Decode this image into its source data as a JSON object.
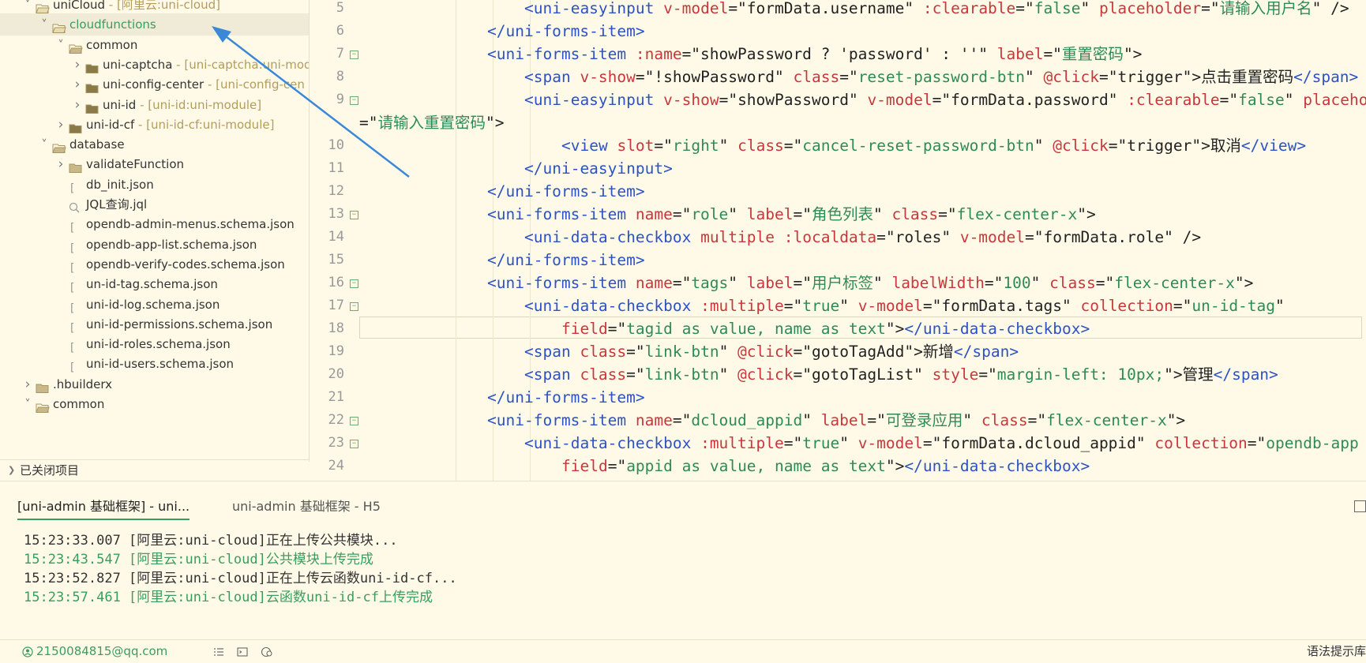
{
  "sidebar": {
    "items": [
      {
        "label": "uniCloud",
        "suffix": " - [阿里云:uni-cloud]",
        "depth": 1,
        "expanded": true,
        "type": "cloud-folder"
      },
      {
        "label": "cloudfunctions",
        "suffix": "",
        "depth": 2,
        "expanded": true,
        "type": "cloud-folder",
        "selected": true
      },
      {
        "label": "common",
        "suffix": "",
        "depth": 3,
        "expanded": true,
        "type": "folder-open"
      },
      {
        "label": "uni-captcha",
        "suffix": " - [uni-captcha:uni-mod",
        "depth": 4,
        "expanded": false,
        "type": "module-folder"
      },
      {
        "label": "uni-config-center",
        "suffix": " - [uni-config-cen",
        "depth": 4,
        "expanded": false,
        "type": "module-folder"
      },
      {
        "label": "uni-id",
        "suffix": " - [uni-id:uni-module]",
        "depth": 4,
        "expanded": false,
        "type": "module-folder"
      },
      {
        "label": "uni-id-cf",
        "suffix": " - [uni-id-cf:uni-module]",
        "depth": 3,
        "expanded": false,
        "type": "module-folder"
      },
      {
        "label": "database",
        "suffix": "",
        "depth": 2,
        "expanded": true,
        "type": "folder-open"
      },
      {
        "label": "validateFunction",
        "suffix": "",
        "depth": 3,
        "expanded": false,
        "type": "folder"
      },
      {
        "label": "db_init.json",
        "suffix": "",
        "depth": 3,
        "type": "json"
      },
      {
        "label": "JQL查询.jql",
        "suffix": "",
        "depth": 3,
        "type": "jql"
      },
      {
        "label": "opendb-admin-menus.schema.json",
        "suffix": "",
        "depth": 3,
        "type": "json"
      },
      {
        "label": "opendb-app-list.schema.json",
        "suffix": "",
        "depth": 3,
        "type": "json"
      },
      {
        "label": "opendb-verify-codes.schema.json",
        "suffix": "",
        "depth": 3,
        "type": "json"
      },
      {
        "label": "un-id-tag.schema.json",
        "suffix": "",
        "depth": 3,
        "type": "json"
      },
      {
        "label": "uni-id-log.schema.json",
        "suffix": "",
        "depth": 3,
        "type": "json"
      },
      {
        "label": "uni-id-permissions.schema.json",
        "suffix": "",
        "depth": 3,
        "type": "json"
      },
      {
        "label": "uni-id-roles.schema.json",
        "suffix": "",
        "depth": 3,
        "type": "json"
      },
      {
        "label": "uni-id-users.schema.json",
        "suffix": "",
        "depth": 3,
        "type": "json"
      },
      {
        "label": ".hbuilderx",
        "suffix": "",
        "depth": 1,
        "expanded": false,
        "type": "folder"
      },
      {
        "label": "common",
        "suffix": "",
        "depth": 1,
        "expanded": true,
        "type": "folder-open"
      }
    ],
    "closed_projects": "已关闭项目"
  },
  "editor": {
    "lines": [
      {
        "n": "5",
        "fold": false,
        "indent": 4,
        "tokens": [
          [
            "t",
            "<uni-easyinput"
          ],
          [
            "p",
            " "
          ],
          [
            "a",
            "v-model"
          ],
          [
            "p",
            "=\""
          ],
          [
            "x",
            "formData.username"
          ],
          [
            "p",
            "\" "
          ],
          [
            "a",
            ":clearable"
          ],
          [
            "p",
            "=\""
          ],
          [
            "s",
            "false"
          ],
          [
            "p",
            "\" "
          ],
          [
            "a",
            "placeholder"
          ],
          [
            "p",
            "=\""
          ],
          [
            "s",
            "请输入用户名"
          ],
          [
            "p",
            "\" />"
          ]
        ]
      },
      {
        "n": "6",
        "fold": false,
        "indent": 3,
        "tokens": [
          [
            "t",
            "</uni-forms-item>"
          ]
        ]
      },
      {
        "n": "7",
        "fold": true,
        "indent": 3,
        "tokens": [
          [
            "t",
            "<uni-forms-item"
          ],
          [
            "p",
            " "
          ],
          [
            "a",
            ":name"
          ],
          [
            "p",
            "=\""
          ],
          [
            "x",
            "showPassword ? 'password' : ''"
          ],
          [
            "p",
            "\" "
          ],
          [
            "a",
            "label"
          ],
          [
            "p",
            "=\""
          ],
          [
            "s",
            "重置密码"
          ],
          [
            "p",
            "\">"
          ]
        ]
      },
      {
        "n": "8",
        "fold": false,
        "indent": 4,
        "tokens": [
          [
            "t",
            "<span"
          ],
          [
            "p",
            " "
          ],
          [
            "a",
            "v-show"
          ],
          [
            "p",
            "=\""
          ],
          [
            "x",
            "!showPassword"
          ],
          [
            "p",
            "\" "
          ],
          [
            "a",
            "class"
          ],
          [
            "p",
            "=\""
          ],
          [
            "s",
            "reset-password-btn"
          ],
          [
            "p",
            "\" "
          ],
          [
            "a",
            "@click"
          ],
          [
            "p",
            "=\""
          ],
          [
            "x",
            "trigger"
          ],
          [
            "p",
            "\">点击重置密码"
          ],
          [
            "t",
            "</span>"
          ]
        ]
      },
      {
        "n": "9",
        "fold": true,
        "indent": 4,
        "tokens": [
          [
            "t",
            "<uni-easyinput"
          ],
          [
            "p",
            " "
          ],
          [
            "a",
            "v-show"
          ],
          [
            "p",
            "=\""
          ],
          [
            "x",
            "showPassword"
          ],
          [
            "p",
            "\" "
          ],
          [
            "a",
            "v-model"
          ],
          [
            "p",
            "=\""
          ],
          [
            "x",
            "formData.password"
          ],
          [
            "p",
            "\" "
          ],
          [
            "a",
            ":clearable"
          ],
          [
            "p",
            "=\""
          ],
          [
            "s",
            "false"
          ],
          [
            "p",
            "\" "
          ],
          [
            "a",
            "placeholder"
          ]
        ]
      },
      {
        "n": "",
        "fold": false,
        "indent": 0,
        "tokens": [
          [
            "p",
            "=\""
          ],
          [
            "s",
            "请输入重置密码"
          ],
          [
            "p",
            "\">"
          ]
        ]
      },
      {
        "n": "10",
        "fold": false,
        "indent": 5,
        "tokens": [
          [
            "t",
            "<view"
          ],
          [
            "p",
            " "
          ],
          [
            "a",
            "slot"
          ],
          [
            "p",
            "=\""
          ],
          [
            "s",
            "right"
          ],
          [
            "p",
            "\" "
          ],
          [
            "a",
            "class"
          ],
          [
            "p",
            "=\""
          ],
          [
            "s",
            "cancel-reset-password-btn"
          ],
          [
            "p",
            "\" "
          ],
          [
            "a",
            "@click"
          ],
          [
            "p",
            "=\""
          ],
          [
            "x",
            "trigger"
          ],
          [
            "p",
            "\">取消"
          ],
          [
            "t",
            "</view>"
          ]
        ]
      },
      {
        "n": "11",
        "fold": false,
        "indent": 4,
        "tokens": [
          [
            "t",
            "</uni-easyinput>"
          ]
        ]
      },
      {
        "n": "12",
        "fold": false,
        "indent": 3,
        "tokens": [
          [
            "t",
            "</uni-forms-item>"
          ]
        ]
      },
      {
        "n": "13",
        "fold": true,
        "indent": 3,
        "tokens": [
          [
            "t",
            "<uni-forms-item"
          ],
          [
            "p",
            " "
          ],
          [
            "a",
            "name"
          ],
          [
            "p",
            "=\""
          ],
          [
            "s",
            "role"
          ],
          [
            "p",
            "\" "
          ],
          [
            "a",
            "label"
          ],
          [
            "p",
            "=\""
          ],
          [
            "s",
            "角色列表"
          ],
          [
            "p",
            "\" "
          ],
          [
            "a",
            "class"
          ],
          [
            "p",
            "=\""
          ],
          [
            "s",
            "flex-center-x"
          ],
          [
            "p",
            "\">"
          ]
        ]
      },
      {
        "n": "14",
        "fold": false,
        "indent": 4,
        "tokens": [
          [
            "t",
            "<uni-data-checkbox"
          ],
          [
            "p",
            " "
          ],
          [
            "a",
            "multiple"
          ],
          [
            "p",
            " "
          ],
          [
            "a",
            ":localdata"
          ],
          [
            "p",
            "=\""
          ],
          [
            "x",
            "roles"
          ],
          [
            "p",
            "\" "
          ],
          [
            "a",
            "v-model"
          ],
          [
            "p",
            "=\""
          ],
          [
            "x",
            "formData.role"
          ],
          [
            "p",
            "\" />"
          ]
        ]
      },
      {
        "n": "15",
        "fold": false,
        "indent": 3,
        "tokens": [
          [
            "t",
            "</uni-forms-item>"
          ]
        ]
      },
      {
        "n": "16",
        "fold": true,
        "indent": 3,
        "tokens": [
          [
            "t",
            "<uni-forms-item"
          ],
          [
            "p",
            " "
          ],
          [
            "a",
            "name"
          ],
          [
            "p",
            "=\""
          ],
          [
            "s",
            "tags"
          ],
          [
            "p",
            "\" "
          ],
          [
            "a",
            "label"
          ],
          [
            "p",
            "=\""
          ],
          [
            "s",
            "用户标签"
          ],
          [
            "p",
            "\" "
          ],
          [
            "a",
            "labelWidth"
          ],
          [
            "p",
            "=\""
          ],
          [
            "s",
            "100"
          ],
          [
            "p",
            "\" "
          ],
          [
            "a",
            "class"
          ],
          [
            "p",
            "=\""
          ],
          [
            "s",
            "flex-center-x"
          ],
          [
            "p",
            "\">"
          ]
        ]
      },
      {
        "n": "17",
        "fold": true,
        "indent": 4,
        "tokens": [
          [
            "t",
            "<uni-data-checkbox"
          ],
          [
            "p",
            " "
          ],
          [
            "a",
            ":multiple"
          ],
          [
            "p",
            "=\""
          ],
          [
            "s",
            "true"
          ],
          [
            "p",
            "\" "
          ],
          [
            "a",
            "v-model"
          ],
          [
            "p",
            "=\""
          ],
          [
            "x",
            "formData.tags"
          ],
          [
            "p",
            "\" "
          ],
          [
            "a",
            "collection"
          ],
          [
            "p",
            "=\""
          ],
          [
            "s",
            "un-id-tag"
          ],
          [
            "p",
            "\""
          ]
        ]
      },
      {
        "n": "18",
        "fold": false,
        "indent": 5,
        "tokens": [
          [
            "a",
            "field"
          ],
          [
            "p",
            "=\""
          ],
          [
            "s",
            "tagid as value, name as text"
          ],
          [
            "p",
            "\">"
          ],
          [
            "t",
            "</uni-data-checkbox>"
          ]
        ]
      },
      {
        "n": "19",
        "fold": false,
        "indent": 4,
        "tokens": [
          [
            "t",
            "<span"
          ],
          [
            "p",
            " "
          ],
          [
            "a",
            "class"
          ],
          [
            "p",
            "=\""
          ],
          [
            "s",
            "link-btn"
          ],
          [
            "p",
            "\" "
          ],
          [
            "a",
            "@click"
          ],
          [
            "p",
            "=\""
          ],
          [
            "x",
            "gotoTagAdd"
          ],
          [
            "p",
            "\">新增"
          ],
          [
            "t",
            "</span>"
          ]
        ]
      },
      {
        "n": "20",
        "fold": false,
        "indent": 4,
        "tokens": [
          [
            "t",
            "<span"
          ],
          [
            "p",
            " "
          ],
          [
            "a",
            "class"
          ],
          [
            "p",
            "=\""
          ],
          [
            "s",
            "link-btn"
          ],
          [
            "p",
            "\" "
          ],
          [
            "a",
            "@click"
          ],
          [
            "p",
            "=\""
          ],
          [
            "x",
            "gotoTagList"
          ],
          [
            "p",
            "\" "
          ],
          [
            "a",
            "style"
          ],
          [
            "p",
            "=\""
          ],
          [
            "s",
            "margin-left: 10px;"
          ],
          [
            "p",
            "\">管理"
          ],
          [
            "t",
            "</span>"
          ]
        ]
      },
      {
        "n": "21",
        "fold": false,
        "indent": 3,
        "tokens": [
          [
            "t",
            "</uni-forms-item>"
          ]
        ]
      },
      {
        "n": "22",
        "fold": true,
        "indent": 3,
        "tokens": [
          [
            "t",
            "<uni-forms-item"
          ],
          [
            "p",
            " "
          ],
          [
            "a",
            "name"
          ],
          [
            "p",
            "=\""
          ],
          [
            "s",
            "dcloud_appid"
          ],
          [
            "p",
            "\" "
          ],
          [
            "a",
            "label"
          ],
          [
            "p",
            "=\""
          ],
          [
            "s",
            "可登录应用"
          ],
          [
            "p",
            "\" "
          ],
          [
            "a",
            "class"
          ],
          [
            "p",
            "=\""
          ],
          [
            "s",
            "flex-center-x"
          ],
          [
            "p",
            "\">"
          ]
        ]
      },
      {
        "n": "23",
        "fold": true,
        "indent": 4,
        "tokens": [
          [
            "t",
            "<uni-data-checkbox"
          ],
          [
            "p",
            " "
          ],
          [
            "a",
            ":multiple"
          ],
          [
            "p",
            "=\""
          ],
          [
            "s",
            "true"
          ],
          [
            "p",
            "\" "
          ],
          [
            "a",
            "v-model"
          ],
          [
            "p",
            "=\""
          ],
          [
            "x",
            "formData.dcloud_appid"
          ],
          [
            "p",
            "\" "
          ],
          [
            "a",
            "collection"
          ],
          [
            "p",
            "=\""
          ],
          [
            "s",
            "opendb-app"
          ]
        ]
      },
      {
        "n": "24",
        "fold": false,
        "indent": 5,
        "tokens": [
          [
            "a",
            "field"
          ],
          [
            "p",
            "=\""
          ],
          [
            "s",
            "appid as value, name as text"
          ],
          [
            "p",
            "\">"
          ],
          [
            "t",
            "</uni-data-checkbox>"
          ]
        ]
      }
    ]
  },
  "console": {
    "tabs": [
      {
        "label": "[uni-admin 基础框架] - uni..."
      },
      {
        "label": "uni-admin 基础框架 - H5"
      }
    ],
    "logs": [
      {
        "text": "15:23:33.007 [阿里云:uni-cloud]正在上传公共模块...",
        "status": "info"
      },
      {
        "text": "15:23:43.547 [阿里云:uni-cloud]公共模块上传完成",
        "status": "success"
      },
      {
        "text": "15:23:52.827 [阿里云:uni-cloud]正在上传云函数uni-id-cf...",
        "status": "info"
      },
      {
        "text": "15:23:57.461 [阿里云:uni-cloud]云函数uni-id-cf上传完成",
        "status": "success"
      }
    ]
  },
  "statusbar": {
    "account": "2150084815@qq.com",
    "right_text": "语法提示库"
  },
  "colors": {
    "background": "#fffae8",
    "accent_green": "#3a9d5d",
    "tag_blue": "#2c52c4",
    "attr_red": "#c8373b",
    "string_green": "#2e8b57",
    "annotation_arrow": "#3a88d8"
  }
}
